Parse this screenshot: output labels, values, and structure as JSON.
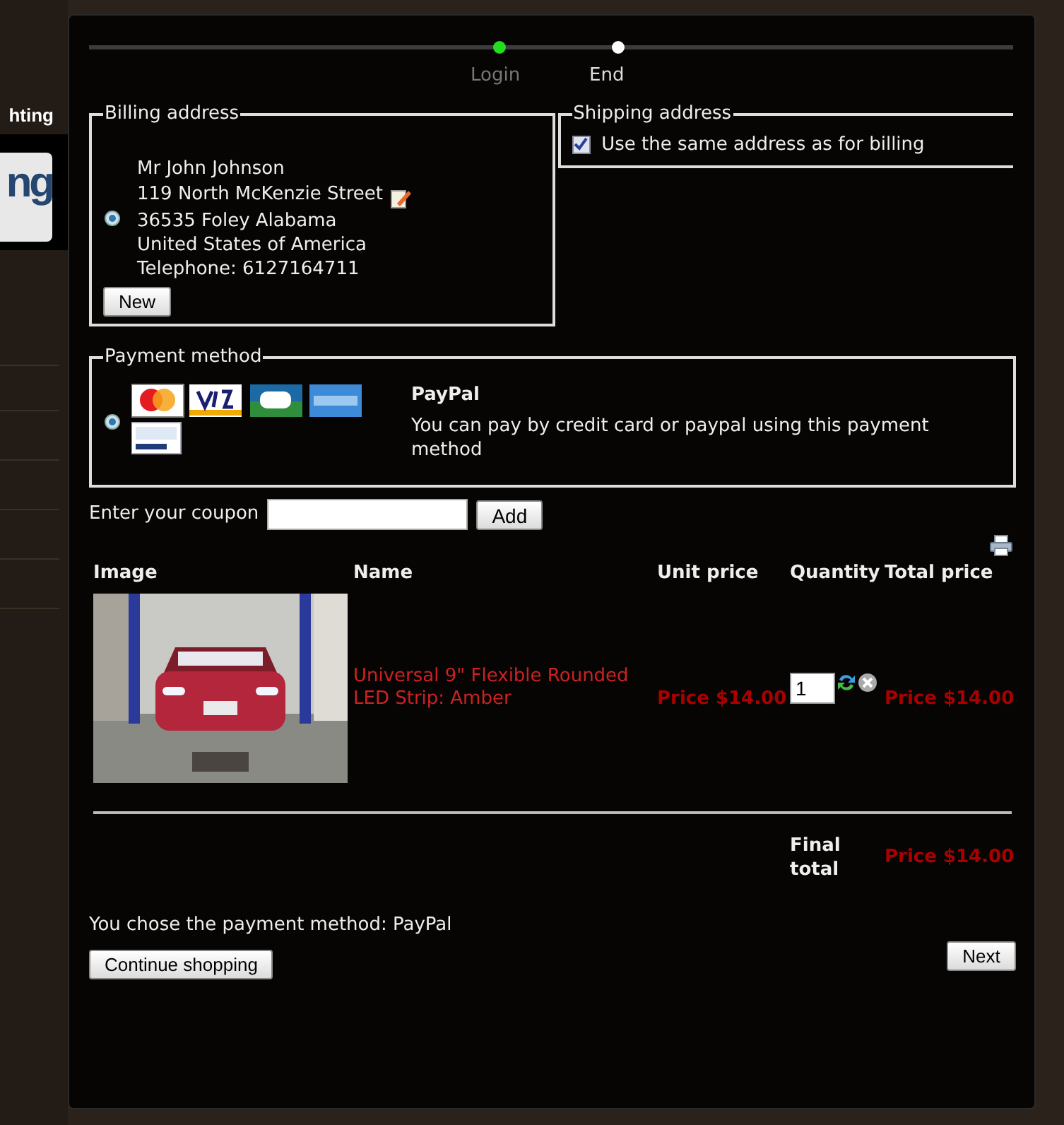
{
  "site": {
    "header_fragment": "hting",
    "logo_fragment": "ng"
  },
  "steps": [
    {
      "label": "Login",
      "done": true
    },
    {
      "label": "End",
      "done": false
    }
  ],
  "billing": {
    "legend": "Billing address",
    "selected": true,
    "lines": [
      "Mr John Johnson",
      "119 North McKenzie Street",
      "36535 Foley Alabama",
      "United States of America",
      "Telephone: 6127164711"
    ],
    "new_button": "New"
  },
  "shipping": {
    "legend": "Shipping address",
    "same_as_billing": {
      "label": "Use the same address as for billing",
      "checked": true
    }
  },
  "payment": {
    "legend": "Payment method",
    "methods": [
      {
        "selected": true,
        "title": "PayPal",
        "description": "You can pay by credit card or paypal using this payment method"
      }
    ]
  },
  "coupon": {
    "label": "Enter your coupon",
    "button": "Add"
  },
  "cart": {
    "columns": [
      "Image",
      "Name",
      "Unit price",
      "Quantity",
      "Total price"
    ],
    "rows": [
      {
        "name": "Universal 9\" Flexible Rounded LED Strip: Amber",
        "unit_price": "Price $14.00",
        "quantity": "1",
        "total_price": "Price $14.00"
      }
    ],
    "final_total_label": "Final total",
    "final_total": "Price $14.00"
  },
  "chosen_method": "You chose the payment method: PayPal",
  "buttons": {
    "continue": "Continue shopping",
    "next": "Next"
  }
}
